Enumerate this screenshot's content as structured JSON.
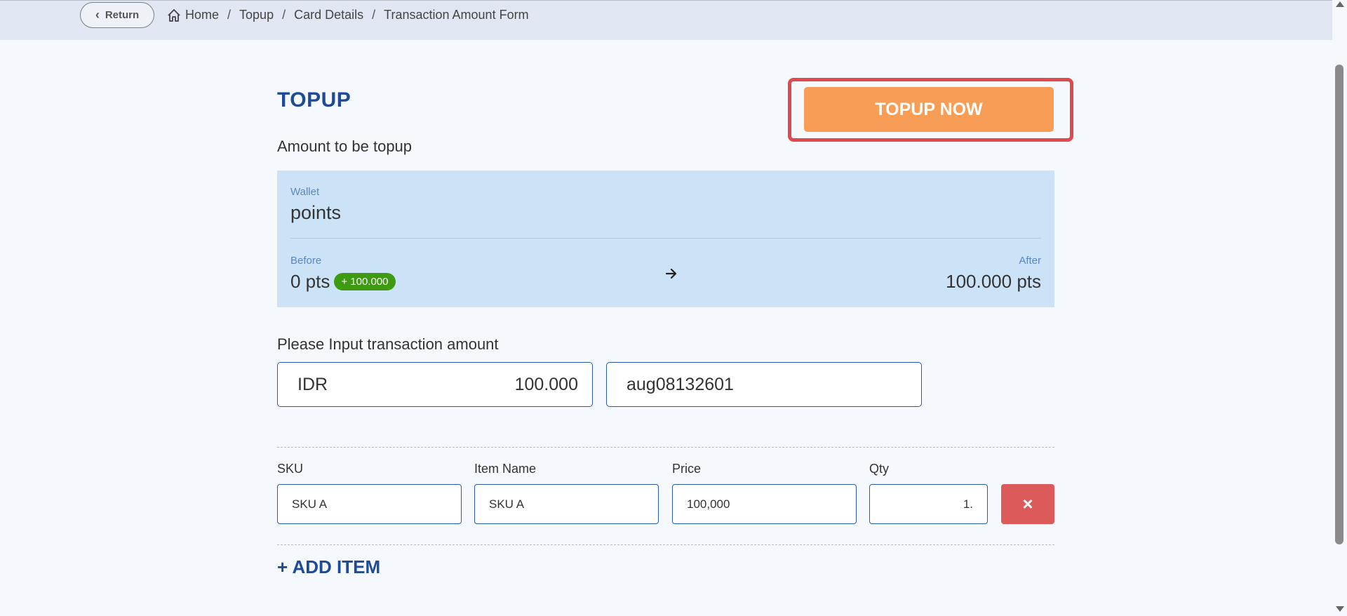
{
  "header": {
    "return_label": "Return",
    "breadcrumb": [
      "Home",
      "Topup",
      "Card Details",
      "Transaction Amount Form"
    ]
  },
  "page": {
    "title": "TOPUP",
    "topup_button": "TOPUP NOW",
    "subtitle": "Amount to be topup"
  },
  "wallet": {
    "label": "Wallet",
    "name": "points",
    "before_label": "Before",
    "before_value": "0 pts",
    "badge": "+ 100.000",
    "after_label": "After",
    "after_value": "100.000 pts"
  },
  "transaction": {
    "label": "Please Input transaction amount",
    "currency": "IDR",
    "amount": "100.000",
    "reference": "aug08132601"
  },
  "items": {
    "headers": [
      "SKU",
      "Item Name",
      "Price",
      "Qty"
    ],
    "row": {
      "sku": "SKU A",
      "name": "SKU A",
      "price": "100,000",
      "qty": "1."
    },
    "delete_symbol": "×",
    "add_label": "+ ADD ITEM"
  },
  "colors": {
    "accent": "#1f4a96",
    "topup_button": "#f79d56",
    "highlight_border": "#e14a4c",
    "wallet_bg": "#cce3f7",
    "badge": "#3d9a11",
    "delete": "#dc5a5a"
  },
  "icons": {
    "return": "chevron-left-icon",
    "home": "home-icon",
    "arrow": "arrow-right-icon",
    "delete": "close-icon"
  }
}
